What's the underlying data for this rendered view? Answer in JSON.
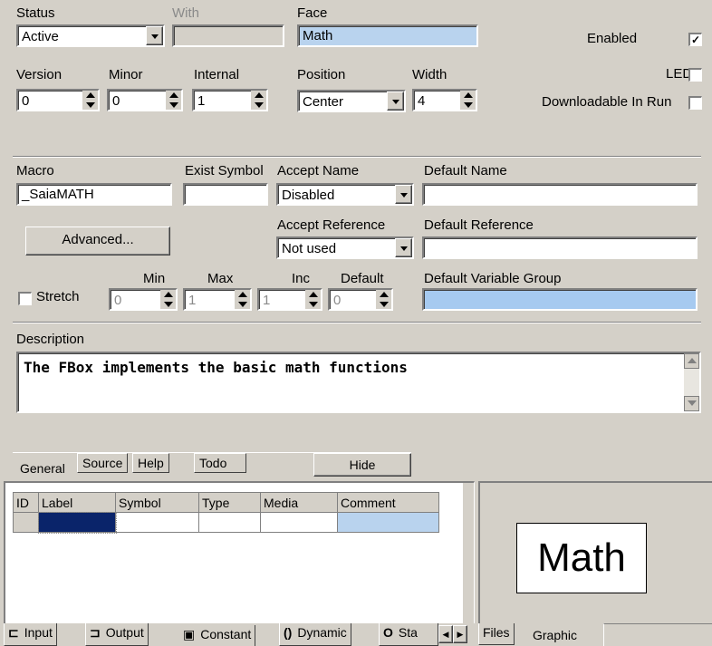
{
  "general": {
    "status_label": "Status",
    "status_value": "Active",
    "with_label": "With",
    "with_value": "",
    "face_label": "Face",
    "face_value": "Math",
    "enabled_label": "Enabled",
    "enabled_checked": "✓",
    "led_label": "LED",
    "downloadable_label": "Downloadable In Run",
    "version_label": "Version",
    "version_value": "0",
    "minor_label": "Minor",
    "minor_value": "0",
    "internal_label": "Internal",
    "internal_value": "1",
    "position_label": "Position",
    "position_value": "Center",
    "width_label": "Width",
    "width_value": "4",
    "macro_label": "Macro",
    "macro_value": "_SaiaMATH",
    "exist_symbol_label": "Exist Symbol",
    "exist_symbol_value": "",
    "accept_name_label": "Accept Name",
    "accept_name_value": "Disabled",
    "default_name_label": "Default Name",
    "default_name_value": "",
    "advanced_button": "Advanced...",
    "accept_reference_label": "Accept Reference",
    "accept_reference_value": "Not used",
    "default_reference_label": "Default Reference",
    "default_reference_value": "",
    "stretch_label": "Stretch",
    "min_label": "Min",
    "min_value": "0",
    "max_label": "Max",
    "max_value": "1",
    "inc_label": "Inc",
    "inc_value": "1",
    "default_label": "Default",
    "default_value": "0",
    "default_var_group_label": "Default Variable Group",
    "default_var_group_value": "",
    "description_label": "Description",
    "description_value": "The FBox implements the basic math functions"
  },
  "tabs": [
    "General",
    "Source",
    "Help",
    "Todo"
  ],
  "hide_button": "Hide",
  "table": {
    "headers": [
      "ID",
      "Label",
      "Symbol",
      "Type",
      "Media",
      "Comment"
    ]
  },
  "bottom_tabs": [
    "Input",
    "Output",
    "Constant",
    "Dynamic",
    "Sta"
  ],
  "right_tabs": [
    "Files",
    "Graphic"
  ],
  "preview_text": "Math",
  "colors": {
    "bg": "#d4d0c8",
    "highlight": "#b9d3ee",
    "selected_cell": "#0a246a"
  }
}
